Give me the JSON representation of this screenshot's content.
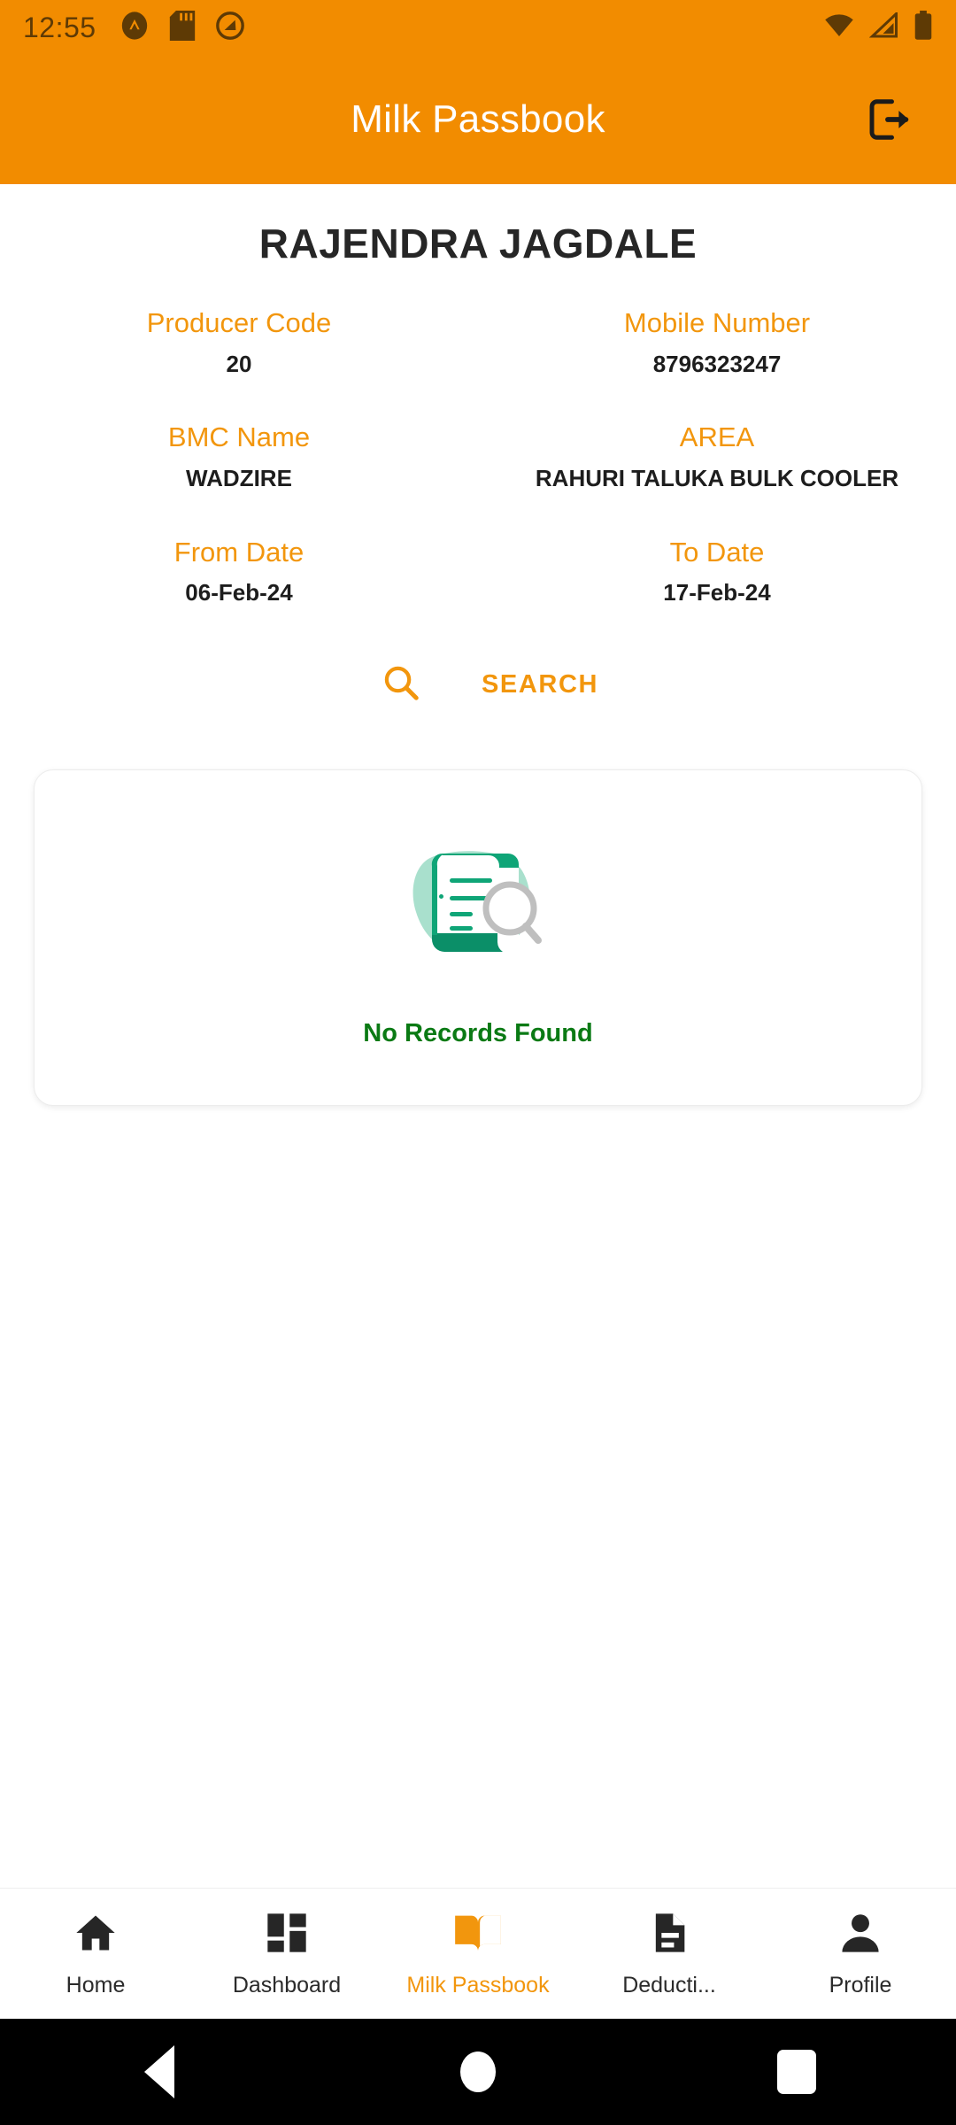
{
  "status_bar": {
    "time": "12:55",
    "left_icons": [
      "caret-badge-icon",
      "sd-card-icon",
      "do-not-disturb-icon"
    ],
    "right_icons": [
      "wifi-icon",
      "cellular-signal-icon",
      "battery-icon"
    ]
  },
  "app_bar": {
    "title": "Milk Passbook",
    "logout_icon": "logout-icon",
    "background_color": "#F28C00",
    "title_color": "#FFFFFF"
  },
  "producer": {
    "name": "RAJENDRA JAGDALE"
  },
  "details": [
    {
      "label": "Producer Code",
      "value": "20"
    },
    {
      "label": "Mobile Number",
      "value": "8796323247"
    },
    {
      "label": "BMC Name",
      "value": "WADZIRE"
    },
    {
      "label": "AREA",
      "value": "RAHURI TALUKA BULK COOLER"
    },
    {
      "label": "From Date",
      "value": "06-Feb-24"
    },
    {
      "label": "To Date",
      "value": "17-Feb-24"
    }
  ],
  "search": {
    "icon": "search-icon",
    "label": "SEARCH",
    "accent_color": "#F2960D"
  },
  "empty_state": {
    "illustration": "no-records-document-magnifier-illustration",
    "message": "No Records Found",
    "message_color": "#0A7A14"
  },
  "bottom_nav": {
    "active_index": 2,
    "active_color": "#F2960D",
    "items": [
      {
        "label": "Home",
        "icon": "home-icon"
      },
      {
        "label": "Dashboard",
        "icon": "grid-dashboard-icon"
      },
      {
        "label": "Milk Passbook",
        "icon": "open-book-icon"
      },
      {
        "label": "Deducti...",
        "icon": "document-icon"
      },
      {
        "label": "Profile",
        "icon": "person-icon"
      }
    ]
  },
  "android_nav": {
    "back": "back-triangle-icon",
    "home": "home-circle-icon",
    "recents": "recents-square-icon"
  }
}
